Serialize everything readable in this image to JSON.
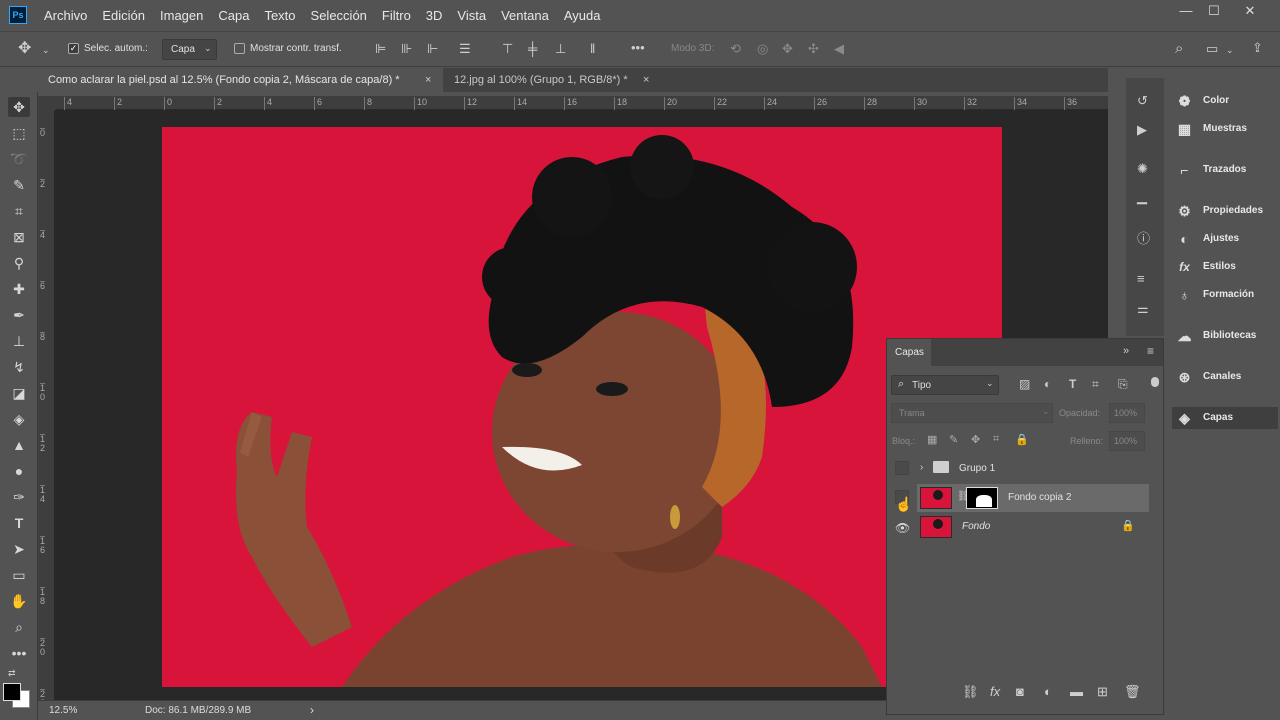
{
  "app": {
    "logo": "Ps"
  },
  "menu": [
    "Archivo",
    "Edición",
    "Imagen",
    "Capa",
    "Texto",
    "Selección",
    "Filtro",
    "3D",
    "Vista",
    "Ventana",
    "Ayuda"
  ],
  "window_controls": {
    "minimize": "—",
    "maximize": "☐",
    "close": "✕"
  },
  "options_bar": {
    "auto_select_label": "Selec. autom.:",
    "auto_select_value": "Capa",
    "show_transform_label": "Mostrar contr. transf.",
    "mode_3d_label": "Modo 3D:",
    "more": "•••"
  },
  "tabs": [
    {
      "label": "Como aclarar la piel.psd al 12.5% (Fondo copia 2, Máscara de capa/8) *",
      "close": "×",
      "active": true
    },
    {
      "label": "12.jpg al 100% (Grupo 1, RGB/8*) *",
      "close": "×",
      "active": false
    }
  ],
  "ruler_top_ticks": [
    "4",
    "2",
    "0",
    "2",
    "4",
    "6",
    "8",
    "10",
    "12",
    "14",
    "16",
    "18",
    "20",
    "22",
    "24",
    "26",
    "28",
    "30",
    "32",
    "34",
    "36"
  ],
  "ruler_left_ticks": [
    "0",
    "2",
    "4",
    "6",
    "8",
    "1\n0",
    "1\n2",
    "1\n4",
    "1\n6",
    "1\n8",
    "2\n0",
    "2\n2"
  ],
  "status": {
    "zoom": "12.5%",
    "doc": "Doc: 86.1 MB/289.9 MB",
    "arrow": "›"
  },
  "right_panels": [
    {
      "label": "Color",
      "icon": "palette-icon"
    },
    {
      "label": "Muestras",
      "icon": "grid-icon"
    },
    {
      "label": "Trazados",
      "icon": "path-icon"
    },
    {
      "label": "Propiedades",
      "icon": "sliders-icon"
    },
    {
      "label": "Ajustes",
      "icon": "half-circle-icon"
    },
    {
      "label": "Estilos",
      "icon": "fx-icon"
    },
    {
      "label": "Formación",
      "icon": "bulb-icon"
    },
    {
      "label": "Bibliotecas",
      "icon": "cloud-icon"
    },
    {
      "label": "Canales",
      "icon": "channels-icon"
    },
    {
      "label": "Capas",
      "icon": "layers-icon",
      "active": true
    }
  ],
  "layers_panel": {
    "title": "Capas",
    "filter_kind": "Tipo",
    "blend_mode": "Trama",
    "opacity_label": "Opacidad:",
    "opacity_value": "100%",
    "lock_label": "Bloq.:",
    "fill_label": "Relleno:",
    "fill_value": "100%",
    "layers": [
      {
        "name": "Grupo 1",
        "type": "group",
        "visible": false
      },
      {
        "name": "Fondo copia 2",
        "type": "masked",
        "visible": false,
        "selected": true
      },
      {
        "name": "Fondo",
        "type": "background",
        "visible": true,
        "locked": true
      }
    ]
  },
  "colors": {
    "photo_bg": "#d8143a",
    "ui_bg": "#535353",
    "canvas_bg": "#282828"
  }
}
